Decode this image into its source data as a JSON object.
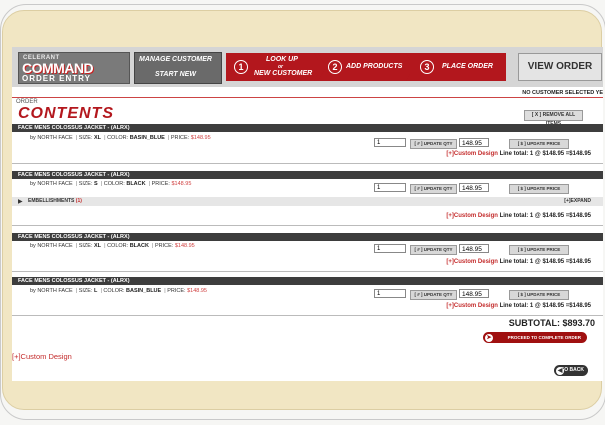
{
  "header": {
    "logo_top": "CELERANT",
    "logo_main": "COMMAND",
    "logo_bottom": "ORDER ENTRY",
    "manage_customer": "MANAGE CUSTOMER",
    "start_new": "START NEW",
    "steps": [
      {
        "num": "1",
        "label": "LOOK UP",
        "label2": "or",
        "label3": "NEW CUSTOMER"
      },
      {
        "num": "2",
        "label": "ADD PRODUCTS"
      },
      {
        "num": "3",
        "label": "PLACE ORDER"
      }
    ],
    "view_order": "VIEW ORDER",
    "no_customer": "NO CUSTOMER SELECTED YE"
  },
  "order": {
    "small_title": "ORDER",
    "title": "CONTENTS",
    "remove_all": "[ X ] REMOVE ALL ITEMS",
    "items": [
      {
        "name": "FACE MENS COLOSSUS JACKET - (ALRX)",
        "brand": "by NORTH FACE",
        "size_label": "SIZE:",
        "size": "XL",
        "color_label": "COLOR:",
        "color": "BASIN_BLUE",
        "price_label": "PRICE:",
        "price": "$148.95",
        "qty": "1",
        "update_qty": "[ # ] UPDATE QTY",
        "price_input": "148.95",
        "update_price": "[ $ ] UPDATE PRICE",
        "custom_design": "[+]Custom Design",
        "line_total": "Line total: 1 @ $148.95 =$148.95"
      },
      {
        "name": "FACE MENS COLOSSUS JACKET - (ALRX)",
        "brand": "by NORTH FACE",
        "size_label": "SIZE:",
        "size": "S",
        "color_label": "COLOR:",
        "color": "BLACK",
        "price_label": "PRICE:",
        "price": "$148.95",
        "qty": "1",
        "update_qty": "[ # ] UPDATE QTY",
        "price_input": "148.95",
        "update_price": "[ $ ] UPDATE PRICE",
        "embellishments": "EMBELLISHMENTS",
        "embellishments_count": "(1)",
        "expand": "[+]EXPAND",
        "custom_design": "[+]Custom Design",
        "line_total": "Line total: 1 @ $148.95 =$148.95"
      },
      {
        "name": "FACE MENS COLOSSUS JACKET - (ALRX)",
        "brand": "by NORTH FACE",
        "size_label": "SIZE:",
        "size": "XL",
        "color_label": "COLOR:",
        "color": "BLACK",
        "price_label": "PRICE:",
        "price": "$148.95",
        "qty": "1",
        "update_qty": "[ # ] UPDATE QTY",
        "price_input": "148.95",
        "update_price": "[ $ ] UPDATE PRICE",
        "custom_design": "[+]Custom Design",
        "line_total": "Line total: 1 @ $148.95 =$148.95"
      },
      {
        "name": "FACE MENS COLOSSUS JACKET - (ALRX)",
        "brand": "by NORTH FACE",
        "size_label": "SIZE:",
        "size": "L",
        "color_label": "COLOR:",
        "color": "BASIN_BLUE",
        "price_label": "PRICE:",
        "price": "$148.95",
        "qty": "1",
        "update_qty": "[ # ] UPDATE QTY",
        "price_input": "148.95",
        "update_price": "[ $ ] UPDATE PRICE",
        "custom_design": "[+]Custom Design",
        "line_total": "Line total: 1 @ $148.95 =$148.95"
      }
    ],
    "subtotal": "SUBTOTAL: $893.70",
    "proceed": "PROCEED TO COMPLETE ORDER",
    "custom_design_link": "[+]Custom Design",
    "go_back": "GO BACK"
  },
  "colors": {
    "accent_red": "#b3171d",
    "bar_dark": "#3d3d3d",
    "panel_tan": "#f1e6c3"
  }
}
